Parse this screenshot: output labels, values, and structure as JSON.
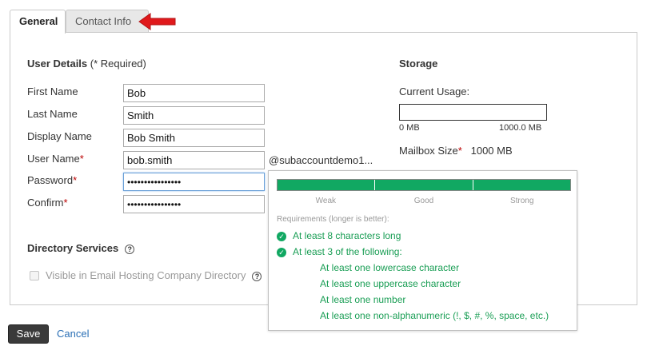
{
  "tabs": [
    {
      "label": "General",
      "active": true
    },
    {
      "label": "Contact Info",
      "active": false
    }
  ],
  "user_details": {
    "title": "User Details",
    "required_note": "(* Required)",
    "fields": [
      {
        "label": "First Name",
        "required": false,
        "value": "Bob"
      },
      {
        "label": "Last Name",
        "required": false,
        "value": "Smith"
      },
      {
        "label": "Display Name",
        "required": false,
        "value": "Bob Smith"
      },
      {
        "label": "User Name",
        "required": true,
        "value": "bob.smith"
      },
      {
        "label": "Password",
        "required": true,
        "value": "••••••••••••••••"
      },
      {
        "label": "Confirm",
        "required": true,
        "value": "••••••••••••••••"
      }
    ],
    "domain_suffix": "@subaccountdemo1...",
    "required_star": "*"
  },
  "directory_services": {
    "title": "Directory Services",
    "help_glyph": "?",
    "checkbox_label": "Visible in Email Hosting Company Directory",
    "checked": false,
    "disabled": true
  },
  "storage": {
    "title": "Storage",
    "current_usage_label": "Current Usage:",
    "usage_fraction": 0.0,
    "scale_min": "0 MB",
    "scale_max": "1000.0 MB",
    "mailbox_size_label": "Mailbox Size",
    "mailbox_size_value": "1000 MB"
  },
  "password_strength": {
    "levels": [
      "Weak",
      "Good",
      "Strong"
    ],
    "strength_level": 3,
    "requirements_title": "Requirements (longer is better):",
    "items": [
      "At least 8 characters long",
      "At least 3 of the following:"
    ],
    "sub_items": [
      "At least one lowercase character",
      "At least one uppercase character",
      "At least one number",
      "At least one non-alphanumeric (!, $, #, %, space, etc.)"
    ],
    "check_glyph": "✓"
  },
  "actions": {
    "save_label": "Save",
    "cancel_label": "Cancel"
  },
  "colors": {
    "accent_green": "#11a862",
    "link_blue": "#2a6fb5",
    "save_button": "#3a3a3a",
    "annotation_arrow": "#e0191c"
  }
}
